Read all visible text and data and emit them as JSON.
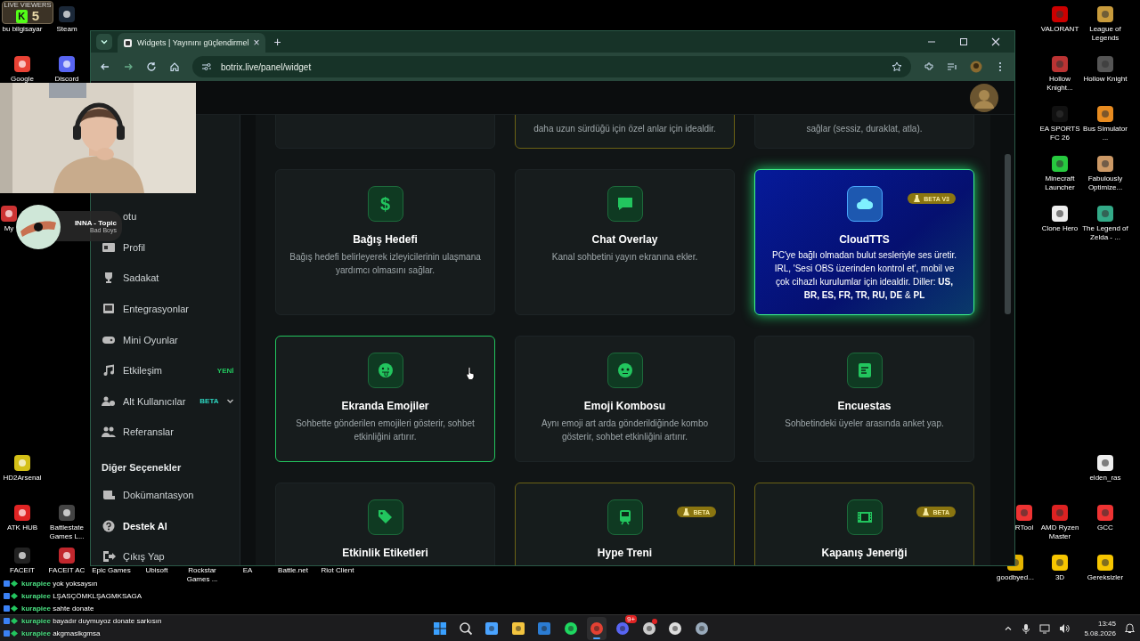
{
  "desktop": {
    "left_icons": [
      {
        "label": "bu bilgisayar"
      },
      {
        "label": "Steam"
      },
      {
        "label": "Google"
      },
      {
        "label": "Discord"
      },
      {
        "label": "My"
      },
      {
        "label": "HD2Arsenal"
      },
      {
        "label": "ATK HUB"
      },
      {
        "label": "Battlestate Games L..."
      },
      {
        "label": "FACEIT"
      },
      {
        "label": "FACEIT AC"
      },
      {
        "label": "Epic Games"
      },
      {
        "label": "Ubisoft"
      },
      {
        "label": "Rockstar Games ..."
      },
      {
        "label": "EA"
      },
      {
        "label": "Battle.net"
      },
      {
        "label": "Riot Client"
      }
    ],
    "right_icons": [
      {
        "label": "VALORANT"
      },
      {
        "label": "League of Legends"
      },
      {
        "label": "Hollow Knight..."
      },
      {
        "label": "Hollow Knight"
      },
      {
        "label": "EA SPORTS FC 26"
      },
      {
        "label": "Bus Simulator ..."
      },
      {
        "label": "Minecraft Launcher"
      },
      {
        "label": "Fabulously Optimize..."
      },
      {
        "label": "Clone Hero"
      },
      {
        "label": "The Legend of Zelda - ..."
      },
      {
        "label": "elden_ras"
      },
      {
        "label": "RTool"
      },
      {
        "label": "AMD Ryzen Master"
      },
      {
        "label": "GCC"
      },
      {
        "label": "goodbyed..."
      },
      {
        "label": "3D"
      },
      {
        "label": "Gereksizler"
      }
    ]
  },
  "browser": {
    "tab": {
      "title": "Widgets | Yayınını güçlendirmel",
      "close": "×"
    },
    "new_tab": "+",
    "url": "botrix.live/panel/widget"
  },
  "sidebar": [
    {
      "kind": "item",
      "label": "otu",
      "emphasized": false
    },
    {
      "kind": "item",
      "label": "Profil",
      "emphasized": false
    },
    {
      "kind": "item",
      "label": "Sadakat",
      "emphasized": false
    },
    {
      "kind": "item",
      "label": "Entegrasyonlar",
      "emphasized": false
    },
    {
      "kind": "item",
      "label": "Mini Oyunlar",
      "emphasized": false
    },
    {
      "kind": "item",
      "label": "Etkileşim",
      "badge": {
        "text": "YENİ",
        "kind": "new"
      },
      "emphasized": false
    },
    {
      "kind": "item",
      "label": "Alt Kullanıcılar",
      "badge": {
        "text": "BETA",
        "kind": "beta"
      },
      "emphasized": false,
      "expandable": true
    },
    {
      "kind": "item",
      "label": "Referanslar",
      "emphasized": false
    },
    {
      "kind": "heading",
      "label": "Diğer Seçenekler"
    },
    {
      "kind": "item",
      "label": "Dokümantasyon",
      "emphasized": false
    },
    {
      "kind": "item",
      "label": "Destek Al",
      "emphasized": true
    },
    {
      "kind": "item",
      "label": "Çıkış Yap",
      "emphasized": false
    }
  ],
  "cards": [
    {
      "kind": "plain",
      "hovered": false
    },
    {
      "kind": "beta",
      "hovered": false,
      "description": "daha uzun sürdüğü için özel anlar için idealdir."
    },
    {
      "kind": "plain",
      "hovered": false,
      "description": "sağlar (sessiz, duraklat, atla)."
    },
    {
      "kind": "plain",
      "hovered": false,
      "icon_text": "$",
      "title": "Bağış Hedefi",
      "description": "Bağış hedefi belirleyerek izleyicilerinin ulaşmana yardımcı olmasını sağlar."
    },
    {
      "kind": "plain",
      "hovered": false,
      "title": "Chat Overlay",
      "description": "Kanal sohbetini yayın ekranına ekler."
    },
    {
      "kind": "featured",
      "hovered": false,
      "badge": "BETA V3",
      "title": "CloudTTS",
      "description": "PC'ye bağlı olmadan bulut sesleriyle ses üretir. IRL, 'Sesi OBS üzerinden kontrol et', mobil ve çok cihazlı kurulumlar için idealdir. Diller: **US, BR, ES, FR, TR, RU, DE** & **PL**"
    },
    {
      "kind": "plain",
      "hovered": true,
      "title": "Ekranda Emojiler",
      "description": "Sohbette gönderilen emojileri gösterir, sohbet etkinliğini artırır."
    },
    {
      "kind": "plain",
      "hovered": false,
      "title": "Emoji Kombosu",
      "description": "Aynı emoji art arda gönderildiğinde kombo gösterir, sohbet etkinliğini artırır."
    },
    {
      "kind": "plain",
      "hovered": false,
      "title": "Encuestas",
      "description": "Sohbetindeki üyeler arasında anket yap."
    },
    {
      "kind": "plain",
      "hovered": false,
      "title": "Etkinlik Etiketleri"
    },
    {
      "kind": "beta",
      "hovered": false,
      "badge": "BETA",
      "title": "Hype Treni"
    },
    {
      "kind": "beta",
      "hovered": false,
      "badge": "BETA",
      "title": "Kapanış Jeneriği"
    }
  ],
  "overlays": {
    "viewers": {
      "label": "LIVE VIEWERS",
      "logo": "K",
      "count": "5"
    },
    "music": {
      "title": "INNA - Topic",
      "subtitle": "Bad Boys"
    },
    "chat": [
      {
        "user": "kurapiee",
        "message": "yok yoksaysın"
      },
      {
        "user": "kurapiee",
        "message": "LŞASÇÖMKLŞAGMKSAGA"
      },
      {
        "user": "kurapiee",
        "message": "sahte donate"
      },
      {
        "user": "kurapiee",
        "message": "bayadır duymuyoz donate sarkısın"
      },
      {
        "user": "kurapiee",
        "message": "akgmaslkgmsa"
      }
    ]
  },
  "taskbar": {
    "apps": [
      {
        "active": false,
        "alert": false
      },
      {
        "active": false,
        "alert": false
      },
      {
        "active": false,
        "alert": false
      },
      {
        "active": false,
        "alert": false
      },
      {
        "active": false,
        "alert": false
      },
      {
        "active": false,
        "alert": false
      },
      {
        "active": true,
        "alert": false
      },
      {
        "active": false,
        "alert": false,
        "badge": "9+"
      },
      {
        "active": false,
        "alert": true
      },
      {
        "active": false,
        "alert": false
      },
      {
        "active": false,
        "alert": false
      }
    ],
    "time": "13:45",
    "date": "5.08.2026"
  }
}
